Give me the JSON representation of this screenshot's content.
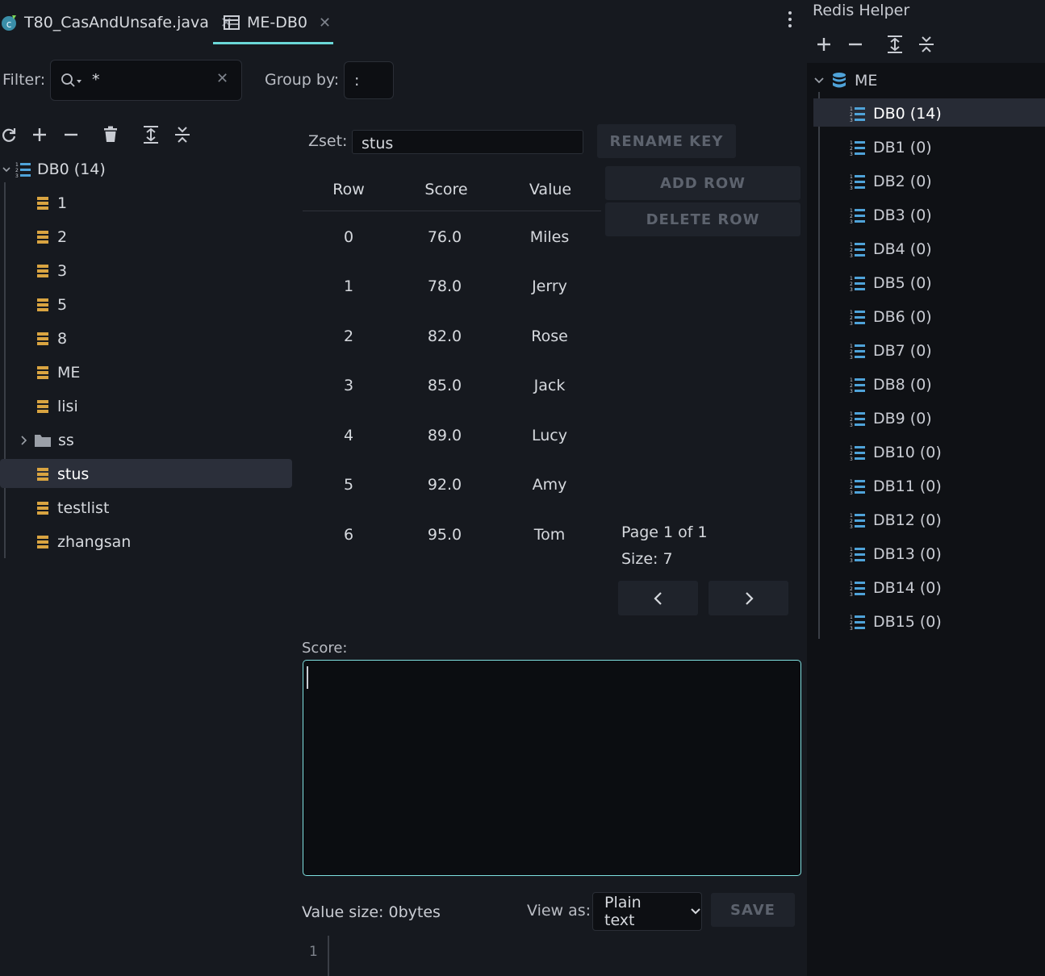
{
  "tabs": [
    {
      "label": "T80_CasAndUnsafe.java",
      "icon": "java-class-icon",
      "active": false
    },
    {
      "label": "ME-DB0",
      "icon": "table-icon",
      "active": true
    }
  ],
  "filter": {
    "label": "Filter:",
    "value": "*",
    "group_label": "Group by:",
    "group_value": ":"
  },
  "left_tree": {
    "root": "DB0 (14)",
    "items": [
      {
        "label": "1",
        "type": "key"
      },
      {
        "label": "2",
        "type": "key"
      },
      {
        "label": "3",
        "type": "key"
      },
      {
        "label": "5",
        "type": "key"
      },
      {
        "label": "8",
        "type": "key"
      },
      {
        "label": "ME",
        "type": "key"
      },
      {
        "label": "lisi",
        "type": "key"
      },
      {
        "label": "ss",
        "type": "folder"
      },
      {
        "label": "stus",
        "type": "key",
        "selected": true
      },
      {
        "label": "testlist",
        "type": "key"
      },
      {
        "label": "zhangsan",
        "type": "key"
      }
    ]
  },
  "editor": {
    "zset_label": "Zset:",
    "zset_value": "stus",
    "rename_key": "RENAME KEY",
    "add_row": "ADD ROW",
    "delete_row": "DELETE ROW",
    "columns": [
      "Row",
      "Score",
      "Value"
    ],
    "rows": [
      {
        "row": "0",
        "score": "76.0",
        "value": "Miles"
      },
      {
        "row": "1",
        "score": "78.0",
        "value": "Jerry"
      },
      {
        "row": "2",
        "score": "82.0",
        "value": "Rose"
      },
      {
        "row": "3",
        "score": "85.0",
        "value": "Jack"
      },
      {
        "row": "4",
        "score": "89.0",
        "value": "Lucy"
      },
      {
        "row": "5",
        "score": "92.0",
        "value": "Amy"
      },
      {
        "row": "6",
        "score": "95.0",
        "value": "Tom"
      }
    ],
    "page": "Page 1 of 1",
    "size": "Size: 7",
    "score_label": "Score:",
    "value_size": "Value size: 0bytes",
    "view_as_label": "View as:",
    "view_as_value": "Plain text",
    "save": "SAVE",
    "line_number": "1"
  },
  "right_panel": {
    "title": "Redis Helper",
    "connection": "ME",
    "databases": [
      "DB0 (14)",
      "DB1 (0)",
      "DB2 (0)",
      "DB3 (0)",
      "DB4 (0)",
      "DB5 (0)",
      "DB6 (0)",
      "DB7 (0)",
      "DB8 (0)",
      "DB9 (0)",
      "DB10 (0)",
      "DB11 (0)",
      "DB12 (0)",
      "DB13 (0)",
      "DB14 (0)",
      "DB15 (0)"
    ],
    "selected_index": 0
  },
  "colors": {
    "accent": "#6ad7d7",
    "key_icon": "#d9a441",
    "db_icon": "#4fa3d9",
    "background": "#16191f"
  }
}
